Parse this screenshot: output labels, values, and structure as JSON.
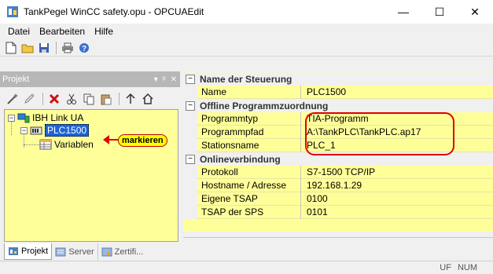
{
  "window": {
    "title": "TankPegel WinCC safety.opu - OPCUAEdit",
    "minimize_glyph": "—",
    "maximize_glyph": "☐",
    "close_glyph": "✕"
  },
  "menu": [
    {
      "label": "Datei"
    },
    {
      "label": "Bearbeiten"
    },
    {
      "label": "Hilfe"
    }
  ],
  "toolbar": {
    "icons": [
      "new-file-icon",
      "open-folder-icon",
      "save-icon",
      "print-icon",
      "help-icon"
    ]
  },
  "left_pane": {
    "header_title": "Projekt",
    "header_controls": [
      "▾",
      "ᵖ",
      "✕"
    ],
    "toolbar_icons": [
      "wand-icon",
      "edit-icon",
      "delete-icon",
      "cut-icon",
      "copy-icon",
      "paste-icon",
      "up-icon",
      "home-icon"
    ],
    "tree": {
      "root": "IBH Link UA",
      "plc": "PLC1500",
      "variables": "Variablen"
    },
    "callout": "markieren",
    "tabs": [
      {
        "label": "Projekt",
        "active": true
      },
      {
        "label": "Server",
        "active": false
      },
      {
        "label": "Zertifi...",
        "active": false
      }
    ]
  },
  "property_grid": {
    "categories": [
      {
        "title": "Name der Steuerung",
        "toggle": "⊟",
        "props": [
          {
            "key": "Name",
            "value": "PLC1500"
          }
        ]
      },
      {
        "title": "Offline Programmzuordnung",
        "toggle": "⊟",
        "props": [
          {
            "key": "Programmtyp",
            "value": "TIA-Programm"
          },
          {
            "key": "Programmpfad",
            "value": "A:\\TankPLC\\TankPLC.ap17"
          },
          {
            "key": "Stationsname",
            "value": "PLC_1"
          }
        ]
      },
      {
        "title": "Onlineverbindung",
        "toggle": "⊟",
        "props": [
          {
            "key": "Protokoll",
            "value": "S7-1500 TCP/IP"
          },
          {
            "key": "Hostname / Adresse",
            "value": "192.168.1.29"
          },
          {
            "key": "Eigene TSAP",
            "value": "0100"
          },
          {
            "key": "TSAP der SPS",
            "value": "0101"
          }
        ]
      }
    ]
  },
  "statusbar": {
    "cells": [
      "UF",
      "NUM"
    ]
  },
  "colors": {
    "grid_bg": "#ffff99",
    "selection": "#1e64d6",
    "annotation_red": "#e00000",
    "callout_bg": "#ffff00"
  }
}
